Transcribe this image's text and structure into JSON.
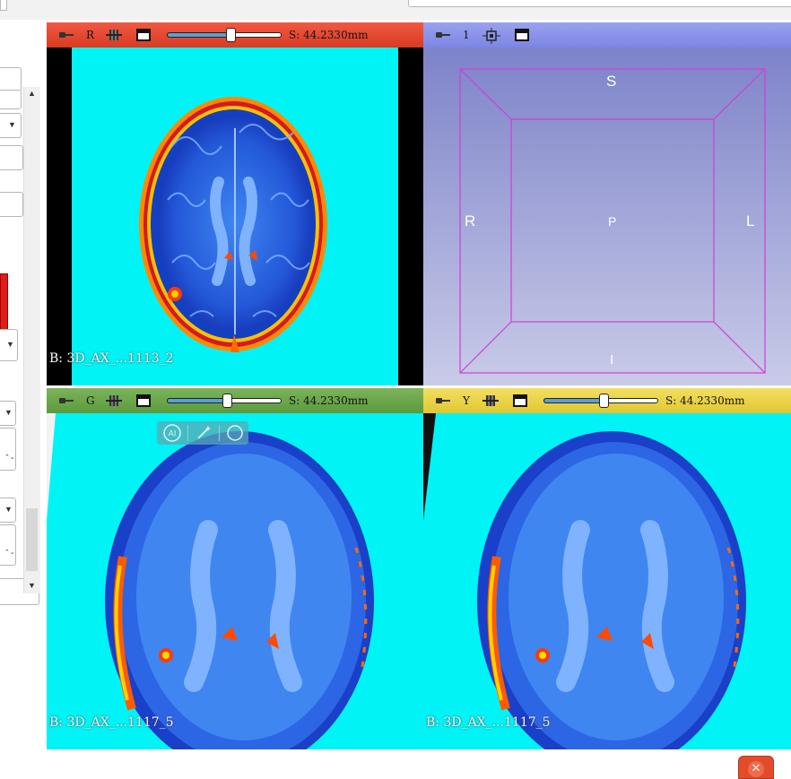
{
  "views": {
    "red": {
      "label": "R",
      "offset": "S: 44.2330mm",
      "slider_pct": 0.56,
      "overlay": "B: 3D_AX_...1113_2",
      "color": "#e8472f"
    },
    "threeD": {
      "label": "1",
      "color": "#8c94ea",
      "directions": {
        "top": "S",
        "left": "R",
        "right": "L",
        "center": "P",
        "bottom": "I"
      }
    },
    "green": {
      "label": "G",
      "offset": "S: 44.2330mm",
      "slider_pct": 0.52,
      "overlay": "B: 3D_AX_...1117_5",
      "color": "#6ba84c"
    },
    "yellow": {
      "label": "Y",
      "offset": "S: 44.2330mm",
      "slider_pct": 0.52,
      "overlay": "B: 3D_AX_...1117_5",
      "color": "#eacf45"
    }
  },
  "ai_toolbar": {
    "ai_label": "AI"
  },
  "colors": {
    "image_background": "#00f3f5",
    "brain_blue": "#2f6fe0",
    "hotspot": "#ff3a00"
  },
  "icons": [
    "pin-icon",
    "layout-icon",
    "maximize-icon",
    "crosshair-icon",
    "ai-icon",
    "magic-wand-icon",
    "circle-icon",
    "close-icon"
  ]
}
